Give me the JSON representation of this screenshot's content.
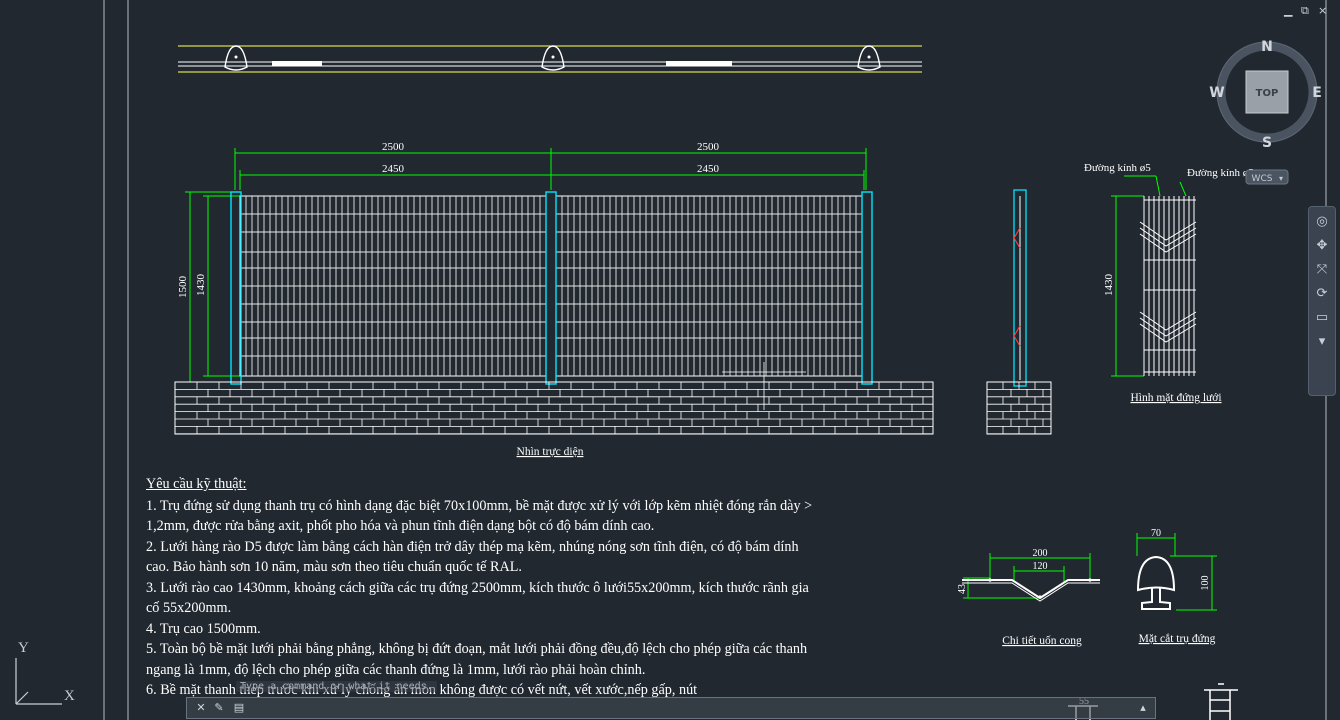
{
  "window": {
    "minimize": "▁",
    "restore": "⧉",
    "close": "×"
  },
  "viewcube": {
    "north": "N",
    "south": "S",
    "east": "E",
    "west": "W",
    "face": "TOP",
    "ucs": "WCS"
  },
  "dims": {
    "front_top_1": "2500",
    "front_top_2": "2500",
    "front_mid_1": "2450",
    "front_mid_2": "2450",
    "front_height_total": "1500",
    "front_height_mesh": "1430",
    "mesh_height": "1430",
    "bend_width": "200",
    "bend_inner": "120",
    "bend_depth": "43",
    "post_width": "70",
    "post_height": "100",
    "bottom_partial": "55"
  },
  "labels": {
    "front_view": "Nhìn trực diện",
    "mesh_elevation": "Hình mặt đứng lưới",
    "diameter_1": "Đường kính ø5",
    "diameter_2": "Đường kính ø5",
    "bend_detail": "Chi tiết uốn cong",
    "post_section": "Mặt cắt trụ đứng"
  },
  "requirements": {
    "title": "Yêu cầu kỹ thuật:",
    "items": [
      "1. Trụ đứng sử dụng thanh trụ có hình dạng đặc biệt 70x100mm, bề mặt được xử lý với lớp kẽm nhiệt đóng rắn dày > 1,2mm, được rửa bằng axit, phốt pho hóa và phun tĩnh điện dạng bột có độ bám dính cao.",
      "2. Lưới hàng rào D5 được làm bằng cách hàn điện trở dây thép mạ kẽm, nhúng nóng sơn tĩnh điện, có độ bám dính cao.  Bảo hành sơn 10 năm, màu sơn theo tiêu chuẩn quốc tế RAL.",
      "3. Lưới rào cao 1430mm, khoảng cách giữa các trụ đứng 2500mm, kích thước ô lưới55x200mm, kích thước rãnh gia cố 55x200mm.",
      "4. Trụ cao 1500mm.",
      "5. Toàn bộ bề mặt lưới phải bằng phẳng, không bị đứt đoạn, mắt lưới phải đồng đều,độ lệch cho phép giữa các thanh ngang là 1mm, độ lệch cho phép giữa các thanh đứng là 1mm, lưới rào phải hoàn chỉnh.",
      "6. Bề mặt thanh thép trước khi xử lý chống ăn mòn không được có vết nứt, vết xước,nếp gấp, nút"
    ]
  },
  "command_line": {
    "hint": "Type a command or what it needs.",
    "value": "",
    "placeholder": ""
  },
  "ucs": {
    "x": "X",
    "y": "Y"
  },
  "colors": {
    "background": "#212830",
    "dimension": "#00ff00",
    "post": "#00e5ff",
    "mesh": "#ffffff",
    "guide": "#d8d84a"
  }
}
